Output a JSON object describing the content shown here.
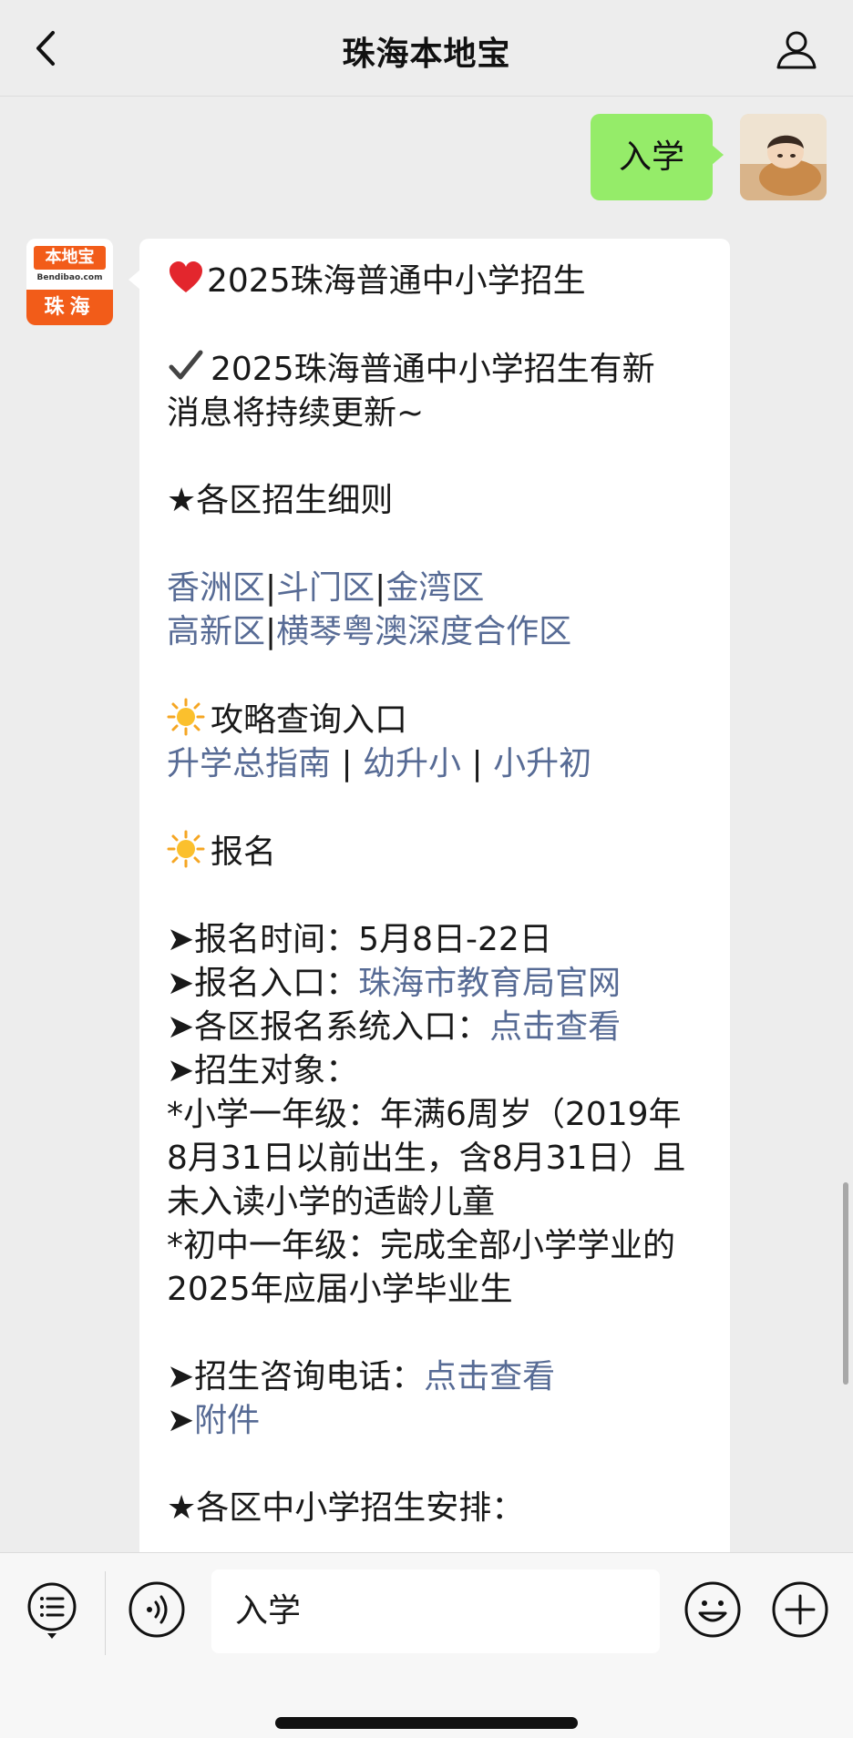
{
  "nav": {
    "title": "珠海本地宝"
  },
  "sent": {
    "text": "入学"
  },
  "bot": {
    "avatar_logo": "本地宝",
    "avatar_url": "Bendibao.com",
    "avatar_city": "珠海"
  },
  "message": {
    "title": "2025珠海普通中小学招生",
    "notice_line1": "2025珠海普通中小学招生有新",
    "notice_line2": "消息将持续更新~",
    "districts_heading": "★各区招生细则",
    "district_xiangzhou": "香洲区",
    "district_doumen": "斗门区",
    "district_jinwan": "金湾区",
    "district_gaoxin": "高新区",
    "district_hengqin": "横琴粤澳深度合作区",
    "sep": "|",
    "guide_heading": "攻略查询入口",
    "guide_total": "升学总指南",
    "guide_primary": "幼升小",
    "guide_middle": "小升初",
    "guide_sep": " | ",
    "signup_heading": "报名",
    "time_label": "➤报名时间：5月8日-22日",
    "entry_label": "➤报名入口：",
    "entry_link": "珠海市教育局官网",
    "system_label": "➤各区报名系统入口：",
    "system_link": "点击查看",
    "target_label": "➤招生对象：",
    "primary_line1": "*小学一年级：年满6周岁（2019年",
    "primary_line2": "8月31日以前出生，含8月31日）且",
    "primary_line3": "未入读小学的适龄儿童",
    "middle_line1": "*初中一年级：完成全部小学学业的",
    "middle_line2": "2025年应届小学毕业生",
    "phone_label": "➤招生咨询电话：",
    "phone_link": "点击查看",
    "attach_arrow": "➤",
    "attach_link": "附件",
    "arrange_heading": "★各区中小学招生安排："
  },
  "input": {
    "value": "入学"
  },
  "colors": {
    "bubble_sent": "#95ec69",
    "link": "#576b95",
    "brand": "#f25c19"
  }
}
